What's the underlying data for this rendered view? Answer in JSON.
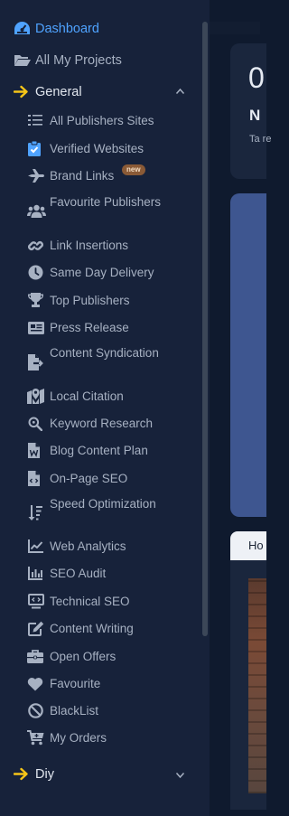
{
  "sidebar": {
    "dashboard": {
      "label": "Dashboard",
      "icon": "speedometer-icon"
    },
    "projects": {
      "label": "All My Projects",
      "icon": "folder-open-icon"
    },
    "general": {
      "label": "General",
      "icon": "arrow-right-icon",
      "expanded": true
    },
    "items": [
      {
        "label": "All Publishers Sites",
        "icon": "list-icon"
      },
      {
        "label": "Verified Websites",
        "icon": "clipboard-check-icon"
      },
      {
        "label": "Brand Links",
        "icon": "plane-icon",
        "badge": "new"
      },
      {
        "label": "Favourite Publishers",
        "icon": "users-icon"
      },
      {
        "label": "Link Insertions",
        "icon": "link-icon"
      },
      {
        "label": "Same Day Delivery",
        "icon": "clock-icon"
      },
      {
        "label": "Top Publishers",
        "icon": "trophy-icon"
      },
      {
        "label": "Press Release",
        "icon": "newspaper-icon"
      },
      {
        "label": "Content Syndication",
        "icon": "file-export-icon"
      },
      {
        "label": "Local Citation",
        "icon": "map-pin-icon"
      },
      {
        "label": "Keyword Research",
        "icon": "search-icon"
      },
      {
        "label": "Blog Content Plan",
        "icon": "file-word-icon"
      },
      {
        "label": "On-Page SEO",
        "icon": "file-code-icon"
      },
      {
        "label": "Speed Optimization",
        "icon": "sort-amount-icon"
      },
      {
        "label": "Web Analytics",
        "icon": "line-chart-icon"
      },
      {
        "label": "SEO Audit",
        "icon": "bar-chart-icon"
      },
      {
        "label": "Technical SEO",
        "icon": "monitor-code-icon"
      },
      {
        "label": "Content Writing",
        "icon": "edit-icon"
      },
      {
        "label": "Open Offers",
        "icon": "briefcase-icon"
      },
      {
        "label": "Favourite",
        "icon": "heart-icon"
      },
      {
        "label": "BlackList",
        "icon": "ban-icon"
      },
      {
        "label": "My Orders",
        "icon": "cart-icon"
      }
    ],
    "diy": {
      "label": "Diy",
      "icon": "arrow-right-icon",
      "expanded": false
    }
  },
  "main": {
    "card": {
      "big_text": "0",
      "heading": "N",
      "subtext": "Ta re"
    },
    "tab": {
      "label": "Ho"
    }
  },
  "colors": {
    "sidebar_bg": "#17223a",
    "page_bg": "#0f1a2e",
    "accent_blue": "#4fa3ff",
    "accent_yellow": "#f5c518",
    "muted_text": "#a7b1c2",
    "banner": "#3e5690"
  }
}
